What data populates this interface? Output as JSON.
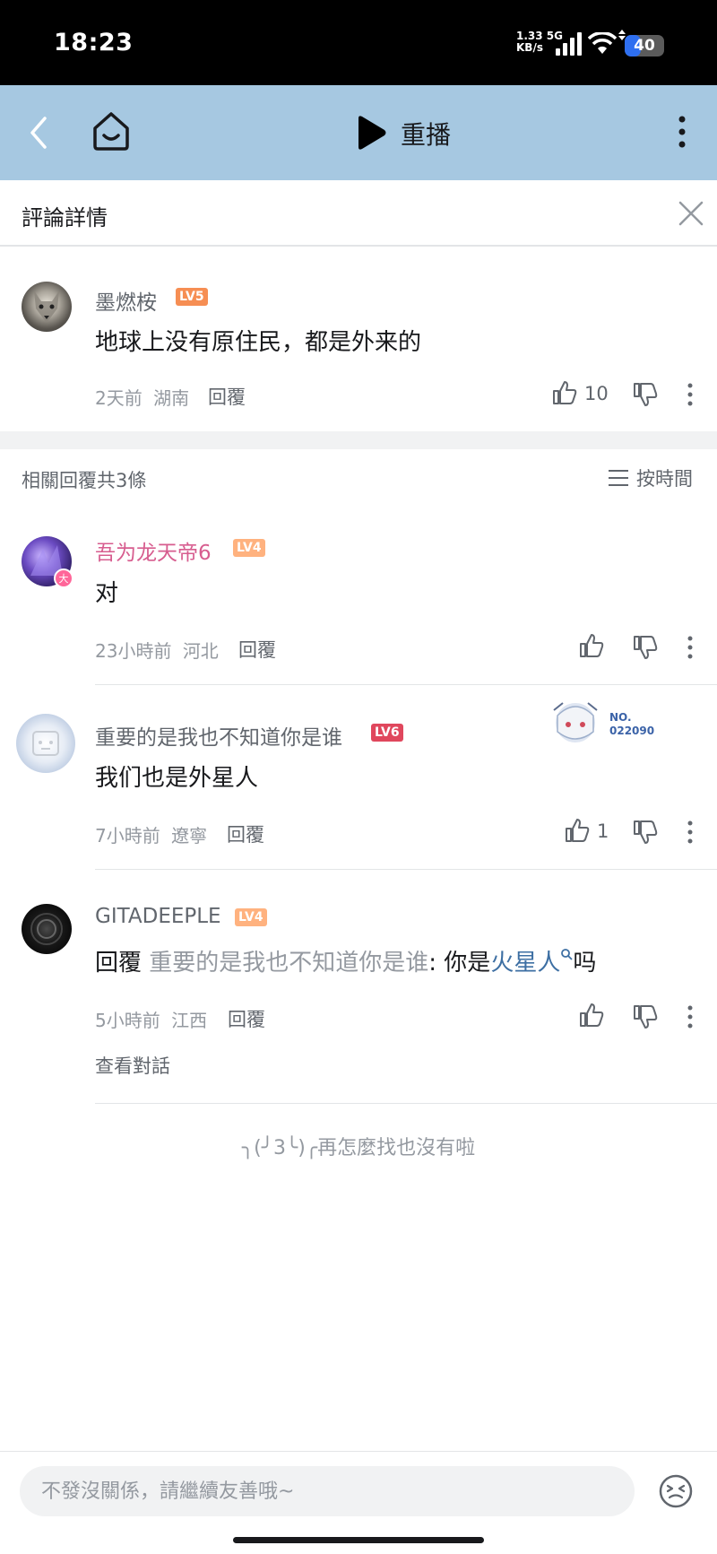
{
  "status_bar": {
    "time": "18:23",
    "net_speed_value": "1.33 5G",
    "net_speed_unit": "KB/s",
    "battery": "40"
  },
  "nav": {
    "title": "重播"
  },
  "detail": {
    "title": "評論詳情"
  },
  "root_comment": {
    "username": "墨燃桉",
    "level": "LV5",
    "content": "地球上没有原住民，都是外来的",
    "time": "2天前",
    "location": "湖南",
    "reply_label": "回覆",
    "likes": "10"
  },
  "replies_header": {
    "count_text": "相關回覆共3條",
    "sort_label": "按時間"
  },
  "replies": [
    {
      "username": "吾为龙天帝6",
      "level": "LV4",
      "content": "对",
      "time": "23小時前",
      "location": "河北",
      "reply_label": "回覆",
      "likes": ""
    },
    {
      "username": "重要的是我也不知道你是谁",
      "level": "LV6",
      "content": "我们也是外星人",
      "time": "7小時前",
      "location": "遼寧",
      "reply_label": "回覆",
      "likes": "1",
      "fan_badge_label": "NO.",
      "fan_badge_number": "022090"
    },
    {
      "username": "GITADEEPLE",
      "level": "LV4",
      "content_prefix": "回覆 ",
      "content_mention": "重要的是我也不知道你是谁",
      "content_middle": ": 你是",
      "content_link": "火星人",
      "content_suffix": "吗",
      "time": "5小時前",
      "location": "江西",
      "reply_label": "回覆",
      "likes": "",
      "view_thread": "查看對話"
    }
  ],
  "end_text": "╮(╯3╰)╭再怎麼找也沒有啦",
  "reply_box": {
    "placeholder": "不發沒關係，請繼續友善哦~"
  },
  "colors": {
    "nav_bg": "#a6c8e1",
    "pink_name": "#d75d8f",
    "link_blue": "#3d6fa3",
    "lv5": "#f68e53",
    "lv4": "#ffb27f",
    "lv6": "#e0475d"
  }
}
